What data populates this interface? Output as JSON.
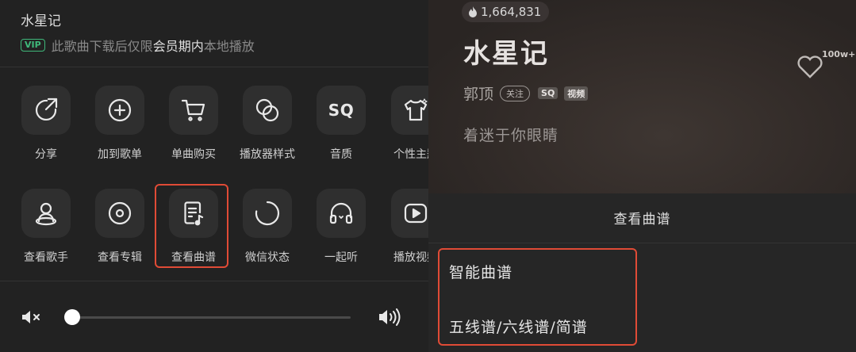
{
  "left_panel": {
    "song_title": "水星记",
    "vip_notice": {
      "badge": "VIP",
      "text_before": "此歌曲下载后仅限",
      "text_highlight": "会员期内",
      "text_after": "本地播放"
    },
    "actions_row1": [
      {
        "label": "分享",
        "icon": "share-icon"
      },
      {
        "label": "加到歌单",
        "icon": "add-circle-icon"
      },
      {
        "label": "单曲购买",
        "icon": "cart-icon"
      },
      {
        "label": "播放器样式",
        "icon": "overlap-circles-icon"
      },
      {
        "label": "音质",
        "icon": "sq-icon",
        "icon_text": "SQ"
      },
      {
        "label": "个性主题",
        "icon": "tshirt-icon"
      }
    ],
    "actions_row2": [
      {
        "label": "查看歌手",
        "icon": "singer-icon"
      },
      {
        "label": "查看专辑",
        "icon": "album-icon"
      },
      {
        "label": "查看曲谱",
        "icon": "sheet-music-icon",
        "highlighted": true
      },
      {
        "label": "微信状态",
        "icon": "wechat-status-icon"
      },
      {
        "label": "一起听",
        "icon": "headphones-icon"
      },
      {
        "label": "播放视频",
        "icon": "video-play-icon"
      }
    ],
    "volume": {
      "level": 0.0,
      "mute_icon": "mute-icon",
      "max_icon": "volume-high-icon"
    }
  },
  "right_panel": {
    "heat_count": "1,664,831",
    "song_title": "水星记",
    "artist": "郭顶",
    "follow_label": "关注",
    "quality_tag": "SQ",
    "video_tag": "视频",
    "lyric_line": "着迷于你眼睛",
    "favorite_count": "100w+",
    "sheet": {
      "title": "查看曲谱",
      "options": [
        "智能曲谱",
        "五线谱/六线谱/简谱"
      ]
    }
  },
  "colors": {
    "highlight_border": "#e04b36",
    "vip_green": "#3fb87a",
    "panel_bg": "#222222"
  }
}
